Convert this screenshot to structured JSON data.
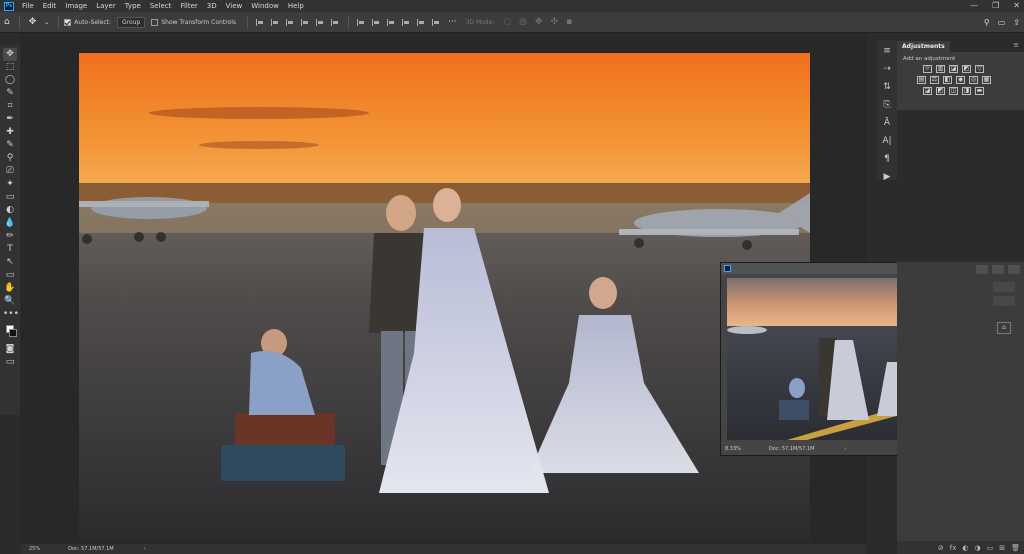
{
  "app": {
    "logo_text": "Ps",
    "menu": [
      "File",
      "Edit",
      "Image",
      "Layer",
      "Type",
      "Select",
      "Filter",
      "3D",
      "View",
      "Window",
      "Help"
    ],
    "window_controls": [
      "—",
      "❐",
      "✕"
    ]
  },
  "options_bar": {
    "home_icon": "home-icon",
    "move_icon": "move-icon",
    "auto_select_label": "Auto-Select:",
    "auto_select_checked": true,
    "auto_select_value": "Group",
    "show_transform_label": "Show Transform Controls",
    "show_transform_checked": false,
    "mode_3d_label": "3D Mode:"
  },
  "tools": [
    "✥",
    "⬚",
    "◯",
    "✎",
    "⌗",
    "✒",
    "✚",
    "✎",
    "⚲",
    "⎚",
    "✦",
    "▭",
    "◐",
    "💧",
    "✏",
    "T",
    "↖",
    "▭",
    "✋",
    "🔍",
    "•••"
  ],
  "panel_strip_icons": [
    "≡",
    "⇢",
    "⇅",
    "⎘",
    "Ȃ",
    "A|",
    "¶",
    "▶"
  ],
  "adjustments_panel": {
    "tab_label": "Adjustments",
    "subtitle": "Add an adjustment",
    "row1": [
      "☼",
      "▥",
      "◪",
      "◩",
      "▽"
    ],
    "row2": [
      "▤",
      "⚖",
      "◧",
      "◉",
      "◎",
      "▦"
    ],
    "row3": [
      "◪",
      "◩",
      "◫",
      "◨",
      "▬"
    ]
  },
  "document_window": {
    "zoom": "8.33%",
    "doc_info": "Doc: 57.1M/57.1M"
  },
  "status_bar": {
    "zoom": "25%",
    "doc_info": "Doc: 57.1M/57.1M"
  },
  "layers_panel": {
    "footer_icons": [
      "⊘",
      "fx",
      "◐",
      "◑",
      "▭",
      "⊞",
      "🗑"
    ]
  },
  "colors": {
    "accent_ps": "#31a8ff",
    "sky_top": "#f0701e",
    "sky_horizon": "#f6b25a"
  }
}
